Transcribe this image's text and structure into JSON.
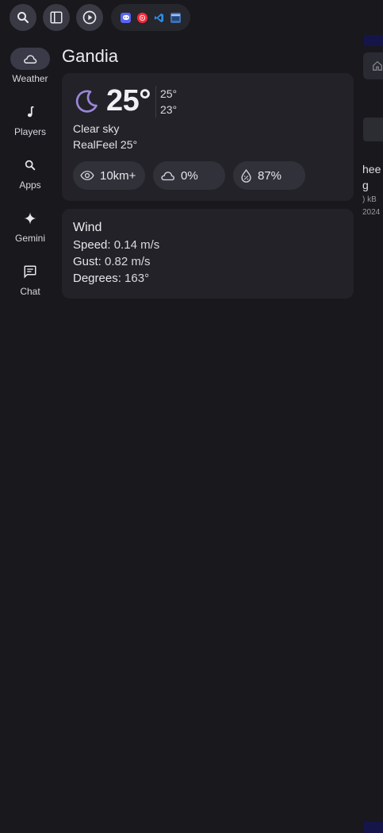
{
  "topbar": {
    "buttons": [
      {
        "icon": "search-icon"
      },
      {
        "icon": "sidebar-toggle-icon"
      },
      {
        "icon": "play-circle-icon"
      }
    ],
    "tray": [
      {
        "icon": "discord-icon",
        "color": "#5865f2"
      },
      {
        "icon": "youtube-music-icon",
        "color": "#ff2a3a"
      },
      {
        "icon": "vscode-icon",
        "color": "#2b8de6"
      },
      {
        "icon": "terminal-icon",
        "color": "#3e6fb5"
      }
    ]
  },
  "sidebar": {
    "items": [
      {
        "label": "Weather",
        "icon": "cloud-icon",
        "active": true
      },
      {
        "label": "Players",
        "icon": "music-note-icon",
        "active": false
      },
      {
        "label": "Apps",
        "icon": "search-icon",
        "active": false
      },
      {
        "label": "Gemini",
        "icon": "sparkle-icon",
        "active": false
      },
      {
        "label": "Chat",
        "icon": "chat-icon",
        "active": false
      }
    ]
  },
  "weather": {
    "city": "Gandia",
    "temperature": "25°",
    "high": "25°",
    "low": "23°",
    "condition": "Clear sky",
    "realfeel": "RealFeel 25°",
    "visibility": "10km+",
    "cloud_cover": "0%",
    "humidity": "87%",
    "accent_color": "#9b86d6"
  },
  "wind": {
    "title": "Wind",
    "speed_label": "Speed:",
    "speed_value": "0.14 m/s",
    "gust_label": "Gust:",
    "gust_value": "0.82 m/s",
    "degrees_label": "Degrees:",
    "degrees_value": "163°"
  },
  "background_window": {
    "title_fragment_1": "hee",
    "title_fragment_2": "g",
    "size_fragment": ") kB",
    "date_fragment": "2024"
  }
}
